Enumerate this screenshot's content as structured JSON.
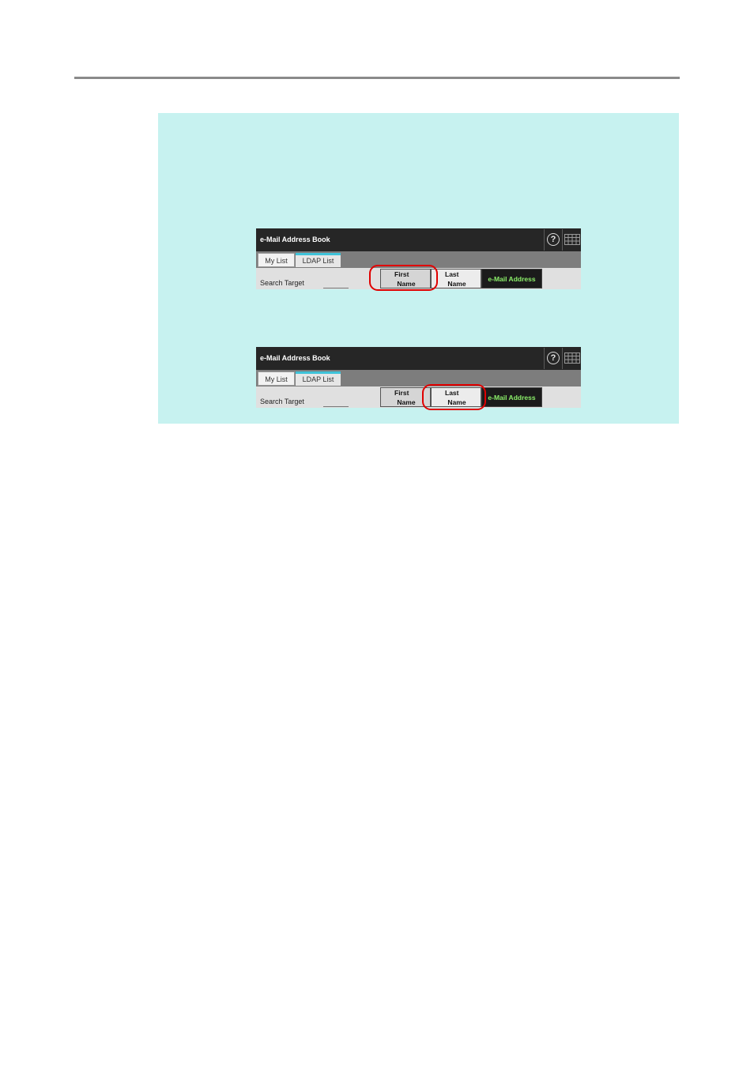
{
  "panels": [
    {
      "title": "e-Mail Address Book",
      "help_glyph": "?",
      "tabs": [
        "My List",
        "LDAP List"
      ],
      "search_label": "Search Target",
      "buttons": {
        "first_l1": "First",
        "first_l2": "Name",
        "last_l1": "Last",
        "last_l2": "Name",
        "email": "e-Mail Address"
      },
      "highlighted": "first-name"
    },
    {
      "title": "e-Mail Address Book",
      "help_glyph": "?",
      "tabs": [
        "My List",
        "LDAP List"
      ],
      "search_label": "Search Target",
      "buttons": {
        "first_l1": "First",
        "first_l2": "Name",
        "last_l1": "Last",
        "last_l2": "Name",
        "email": "e-Mail Address"
      },
      "highlighted": "last-name"
    }
  ],
  "colors": {
    "note_background": "#c7f2f0",
    "titlebar": "#262626",
    "highlight": "#e00000",
    "email_text": "#8cf06a",
    "active_tab_accent": "#3fc3d9"
  },
  "icons": [
    "help-icon",
    "keyboard-icon"
  ]
}
